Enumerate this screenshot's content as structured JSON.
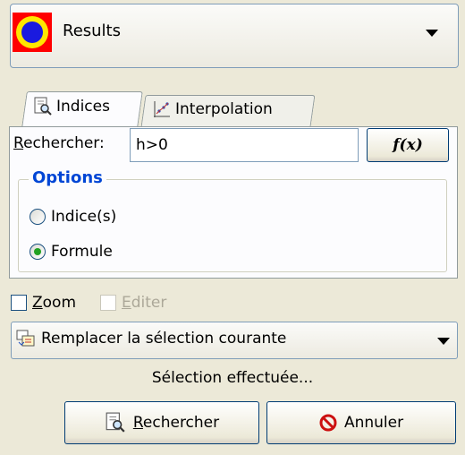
{
  "dataset": {
    "label": "Results"
  },
  "tabs": [
    {
      "label": "Indices",
      "active": true
    },
    {
      "label": "Interpolation",
      "active": false
    }
  ],
  "search": {
    "label": "Rechercher:",
    "value": "h>0"
  },
  "fx_button": {
    "label": "f(x)"
  },
  "options": {
    "title": "Options",
    "radios": [
      {
        "label": "Indice(s)",
        "checked": false
      },
      {
        "label": "Formule",
        "checked": true
      }
    ]
  },
  "checkboxes": {
    "zoom": {
      "label": "Zoom",
      "checked": false
    },
    "editer": {
      "label": "Editer",
      "checked": false,
      "enabled": false
    }
  },
  "selection_mode": {
    "value": "Remplacer la sélection courante"
  },
  "status": "Sélection effectuée...",
  "buttons": {
    "search": "Rechercher",
    "cancel": "Annuler"
  },
  "colors": {
    "accent": "#0046d5",
    "radio_dot": "#21a121",
    "cancel_icon": "#cc1111"
  }
}
